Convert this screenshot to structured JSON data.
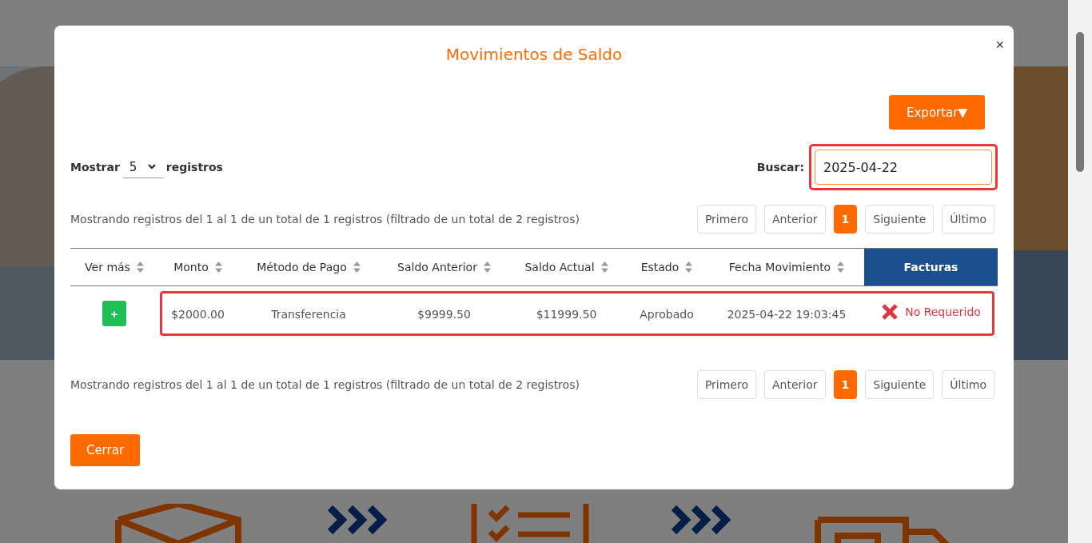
{
  "modal": {
    "title": "Movimientos de Saldo",
    "close": "×",
    "export_button": "Exportar▼",
    "length": {
      "prefix": "Mostrar",
      "value": "5",
      "suffix": "registros"
    },
    "search": {
      "label": "Buscar:",
      "value": "2025-04-22",
      "highlighted": true
    },
    "info_top": "Mostrando registros del 1 al 1 de un total de 1 registros (filtrado de un total de 2 registros)",
    "pagination_top": [
      {
        "label": "Primero",
        "selected": false
      },
      {
        "label": "Anterior",
        "selected": false
      },
      {
        "label": "1",
        "selected": true
      },
      {
        "label": "Siguiente",
        "selected": false
      },
      {
        "label": "Último",
        "selected": false
      }
    ],
    "table": {
      "columns": [
        {
          "label": "Ver más",
          "sortable": true
        },
        {
          "label": "Monto",
          "sortable": true
        },
        {
          "label": "Método de Pago",
          "sortable": true
        },
        {
          "label": "Saldo Anterior",
          "sortable": true
        },
        {
          "label": "Saldo Actual",
          "sortable": true
        },
        {
          "label": "Estado",
          "sortable": true
        },
        {
          "label": "Fecha Movimiento",
          "sortable": true
        },
        {
          "label": "Facturas",
          "sortable": false
        }
      ],
      "rows": [
        {
          "highlighted": true,
          "cells": [
            "+",
            "$2000.00",
            "Transferencia",
            "$9999.50",
            "$11999.50",
            "Aprobado",
            "2025-04-22 19:03:45",
            "No Requerido"
          ]
        }
      ]
    },
    "info_bottom": "Mostrando registros del 1 al 1 de un total de 1 registros (filtrado de un total de 2 registros)",
    "pagination_bottom": [
      {
        "label": "Primero",
        "selected": false
      },
      {
        "label": "Anterior",
        "selected": false
      },
      {
        "label": "1",
        "selected": true
      },
      {
        "label": "Siguiente",
        "selected": false
      },
      {
        "label": "Último",
        "selected": false
      }
    ],
    "close_button": "Cerrar"
  }
}
